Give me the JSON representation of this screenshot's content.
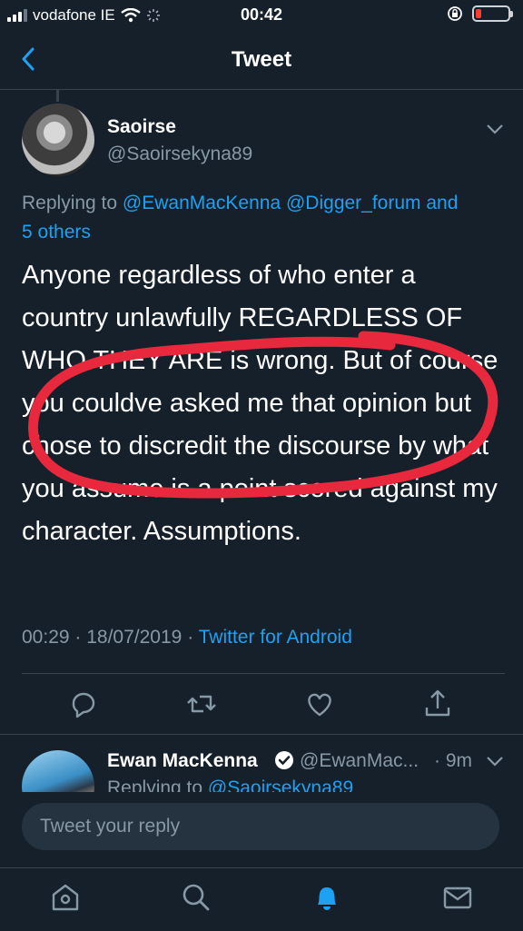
{
  "status_bar": {
    "carrier": "vodafone IE",
    "time": "00:42"
  },
  "nav": {
    "title": "Tweet"
  },
  "tweet": {
    "name": "Saoirse",
    "handle": "@Saoirsekyna89",
    "replying_prefix": "Replying to",
    "replying_mentions": "@EwanMacKenna @Digger_forum",
    "replying_and": "and",
    "replying_others": "5 others",
    "text": "Anyone regardless of who enter a country unlawfully REGARDLESS OF WHO THEY ARE is wrong. But of course you couldve asked me that opinion but chose to discredit the discourse by what you assume is a point scored against my character. Assumptions.",
    "time": "00:29",
    "date": "18/07/2019",
    "source": "Twitter for Android"
  },
  "reply_tweet": {
    "name": "Ewan MacKenna",
    "handle": "@EwanMac...",
    "age": "· 9m",
    "replying_prefix": "Replying to",
    "replying_mention": "@Saoirsekyna89"
  },
  "compose": {
    "placeholder": "Tweet your reply"
  },
  "icons": {
    "actions": [
      "reply-icon",
      "retweet-icon",
      "like-icon",
      "share-icon"
    ],
    "tabs": [
      "home-icon",
      "search-icon",
      "notifications-icon",
      "messages-icon"
    ]
  },
  "colors": {
    "background": "#15202b",
    "link": "#1da1f2",
    "secondary_text": "#8899a6",
    "annotation": "#e8283c"
  }
}
